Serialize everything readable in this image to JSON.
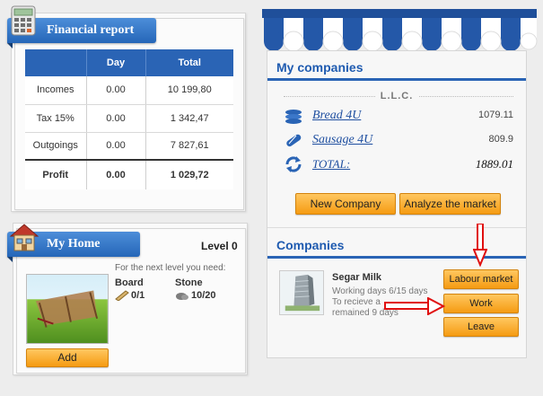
{
  "financial": {
    "title": "Financial report",
    "headers": [
      "",
      "Day",
      "Total"
    ],
    "rows": [
      {
        "label": "Incomes",
        "day": "0.00",
        "total": "10 199,80"
      },
      {
        "label": "Tax 15%",
        "day": "0.00",
        "total": "1 342,47"
      },
      {
        "label": "Outgoings",
        "day": "0.00",
        "total": "7 827,61"
      },
      {
        "label": "Profit",
        "day": "0.00",
        "total": "1 029,72"
      }
    ]
  },
  "home": {
    "title": "My Home",
    "level": "Level 0",
    "need_text": "For the next level you need:",
    "resources": [
      {
        "name": "Board",
        "count": "0/1",
        "icon": "board-icon"
      },
      {
        "name": "Stone",
        "count": "10/20",
        "icon": "stone-icon"
      }
    ],
    "add_label": "Add"
  },
  "my_companies": {
    "title": "My companies",
    "group": "L.L.C.",
    "items": [
      {
        "name": "Bread 4U",
        "value": "1079.11",
        "icon": "bread-icon"
      },
      {
        "name": "Sausage 4U",
        "value": "809.9",
        "icon": "sausage-icon"
      },
      {
        "name": "TOTAL:",
        "value": "1889.01",
        "icon": "refresh-icon"
      }
    ],
    "new_company_label": "New Company",
    "analyze_label": "Analyze the market"
  },
  "companies": {
    "title": "Companies",
    "company_name": "Segar Milk",
    "line1": "Working days 6/15 days",
    "line2": "To recieve a",
    "line3": "remained 9 days",
    "labour_label": "Labour market",
    "work_label": "Work",
    "leave_label": "Leave"
  }
}
